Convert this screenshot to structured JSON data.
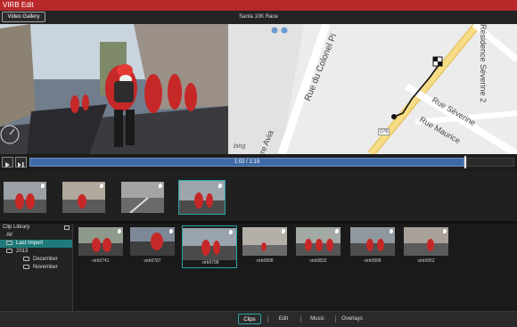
{
  "window": {
    "title": "VIRB Edit"
  },
  "header": {
    "gallery_button": "Video Gallery",
    "video_title": "Santa 10K Race"
  },
  "map": {
    "streets": [
      "Rue du Colonel Pi",
      "Rue Séverine",
      "Rue Maurice",
      "Résidence Séverine 2",
      "rre Avia"
    ],
    "road_number": "D78",
    "brand": "bing"
  },
  "playback": {
    "timecode": "1:02 / 1:19",
    "progress": 0.78
  },
  "clip_library": {
    "title": "Clip Library",
    "items": [
      {
        "label": "All",
        "level": 0,
        "selected": false,
        "folder": false
      },
      {
        "label": "Last Import",
        "level": 0,
        "selected": true,
        "folder": true
      },
      {
        "label": "2013",
        "level": 0,
        "selected": false,
        "folder": true
      },
      {
        "label": "December",
        "level": 1,
        "selected": false,
        "folder": true
      },
      {
        "label": "November",
        "level": 1,
        "selected": false,
        "folder": true
      }
    ]
  },
  "clips": [
    "virb0741",
    "virb0787",
    "virb0798",
    "virb0808",
    "virb0832",
    "virb0898",
    "virb0952"
  ],
  "tabs": [
    "Clips",
    "Edit",
    "Music",
    "Overlays"
  ],
  "active_tab": "Clips",
  "colors": {
    "title_bar": "#b8282b",
    "accent": "#2aa5a5",
    "timeline": "#3f6aa6"
  }
}
